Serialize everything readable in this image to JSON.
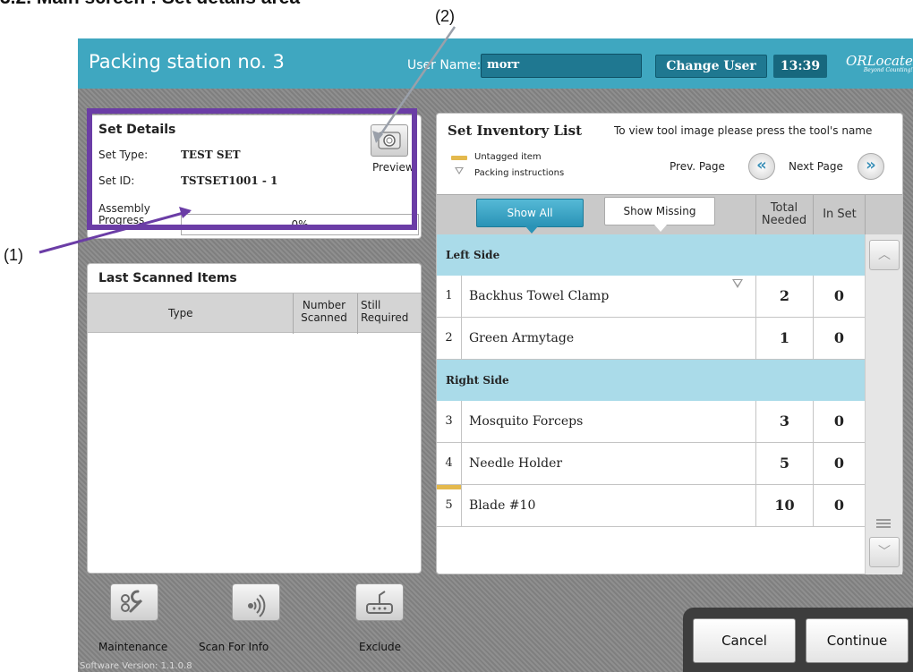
{
  "doc": {
    "heading": "3.2. Main screen : Set details area",
    "callout_1": "(1)",
    "callout_2": "(2)"
  },
  "header": {
    "station": "Packing station no. 3",
    "user_label": "User Name:",
    "user_value": "morr",
    "change_user": "Change User",
    "time": "13:39",
    "logo": "ORLocate",
    "logo_tagline": "Beyond Counting!"
  },
  "set_details": {
    "title": "Set Details",
    "type_label": "Set Type:",
    "type_value": "TEST SET",
    "id_label": "Set ID:",
    "id_value": "TSTSET1001 - 1",
    "progress_label": "Assembly Progress",
    "progress_text": "0%",
    "progress_fraction": 0,
    "preview_label": "Preview"
  },
  "last_scanned": {
    "title": "Last Scanned Items",
    "col_type": "Type",
    "col_number": "Number Scanned",
    "col_still": "Still Required"
  },
  "inventory": {
    "title": "Set Inventory List",
    "hint": "To view tool image please press the tool's name",
    "legend_untagged": "Untagged item",
    "legend_packing": "Packing instructions",
    "prev_page": "Prev. Page",
    "next_page": "Next Page",
    "show_all": "Show All",
    "show_missing": "Show Missing",
    "col_total": "Total Needed",
    "col_inset": "In Set",
    "sections": [
      {
        "name": "Left Side"
      },
      {
        "name": "Right Side"
      }
    ],
    "items": [
      {
        "num": "1",
        "name": "Backhus Towel Clamp",
        "needed": "2",
        "inset": "0"
      },
      {
        "num": "2",
        "name": "Green Armytage",
        "needed": "1",
        "inset": "0"
      },
      {
        "num": "3",
        "name": "Mosquito Forceps",
        "needed": "3",
        "inset": "0"
      },
      {
        "num": "4",
        "name": "Needle Holder",
        "needed": "5",
        "inset": "0"
      },
      {
        "num": "5",
        "name": "Blade #10",
        "needed": "10",
        "inset": "0"
      }
    ]
  },
  "tools": {
    "maintenance": "Maintenance",
    "scan_info": "Scan For Info",
    "exclude": "Exclude"
  },
  "actions": {
    "cancel": "Cancel",
    "continue": "Continue"
  },
  "footer": {
    "version": "Software Version: 1.1.0.8"
  },
  "colors": {
    "header": "#3fa7c0",
    "section_row": "#aadbe9",
    "highlight": "#6b3da6",
    "untagged": "#e4b94d"
  }
}
